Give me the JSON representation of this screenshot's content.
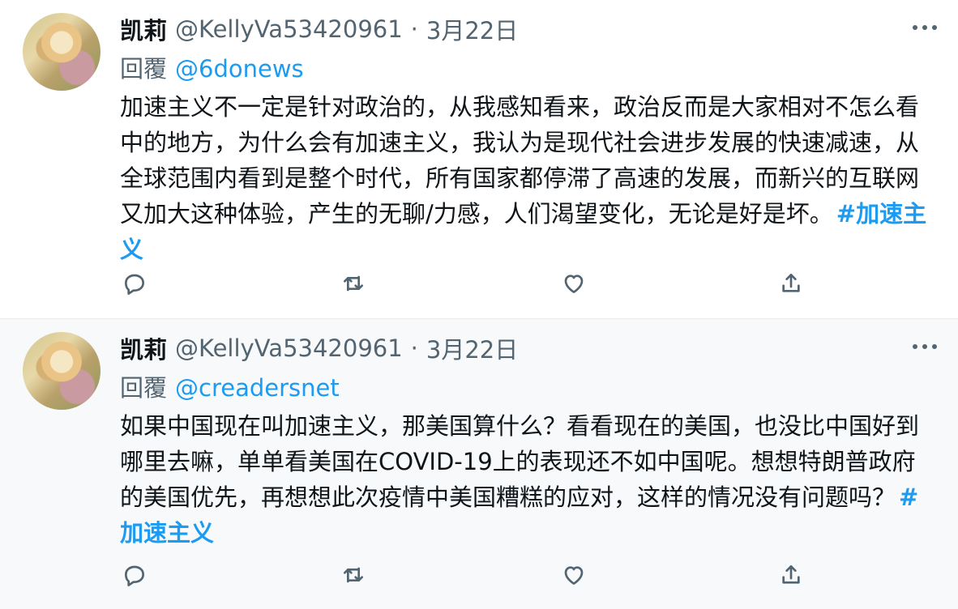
{
  "tweets": [
    {
      "author": "凯莉",
      "handle": "@KellyVa53420961",
      "dot": "·",
      "date": "3月22日",
      "reply_prefix": "回覆",
      "reply_to": "@6donews",
      "text": "加速主义不一定是针对政治的，从我感知看来，政治反而是大家相对不怎么看中的地方，为什么会有加速主义，我认为是现代社会进步发展的快速减速，从全球范围内看到是整个时代，所有国家都停滞了高速的发展，而新兴的互联网又加大这种体验，产生的无聊/力感，人们渴望变化，无论是好是坏。",
      "hashtag": "#加速主义"
    },
    {
      "author": "凯莉",
      "handle": "@KellyVa53420961",
      "dot": "·",
      "date": "3月22日",
      "reply_prefix": "回覆",
      "reply_to": "@creadersnet",
      "text": "如果中国现在叫加速主义，那美国算什么？看看现在的美国，也没比中国好到哪里去嘛，单单看美国在COVID-19上的表现还不如中国呢。想想特朗普政府的美国优先，再想想此次疫情中美国糟糕的应对，这样的情况没有问题吗？",
      "hashtag": "#加速主义"
    }
  ],
  "icons": {
    "more": "more-icon",
    "reply": "reply-icon",
    "retweet": "retweet-icon",
    "like": "like-icon",
    "share": "share-icon"
  },
  "colors": {
    "link": "#1d9bf0",
    "secondary_text": "#536471",
    "highlight_bg": "#f7f9fa"
  }
}
